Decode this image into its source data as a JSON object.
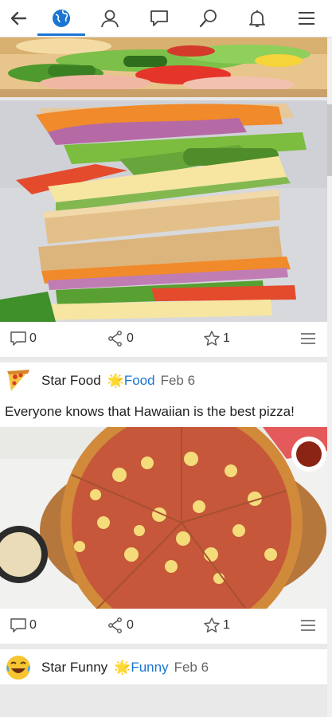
{
  "nav": {
    "items": [
      {
        "name": "back-arrow-icon"
      },
      {
        "name": "globe-icon",
        "active": true
      },
      {
        "name": "user-icon"
      },
      {
        "name": "chat-bubble-icon"
      },
      {
        "name": "search-icon"
      },
      {
        "name": "bell-icon"
      },
      {
        "name": "hamburger-menu-icon"
      }
    ],
    "accent_color": "#1a76d2"
  },
  "post_1": {
    "image_1": "sandwich close-up",
    "image_2": "stacked sandwich",
    "actions": {
      "comments": "0",
      "shares": "0",
      "stars": "1"
    }
  },
  "post_2": {
    "author": "Star Food",
    "category": "Food",
    "date": "Feb 6",
    "avatar_icon": "pizza-slice-icon",
    "text": "Everyone knows that Hawaiian is the best pizza!",
    "image": "hawaiian pizza",
    "actions": {
      "comments": "0",
      "shares": "0",
      "stars": "1"
    }
  },
  "post_3": {
    "author": "Star Funny",
    "category": "Funny",
    "date": "Feb 6",
    "avatar_icon": "laughing-face-icon"
  }
}
